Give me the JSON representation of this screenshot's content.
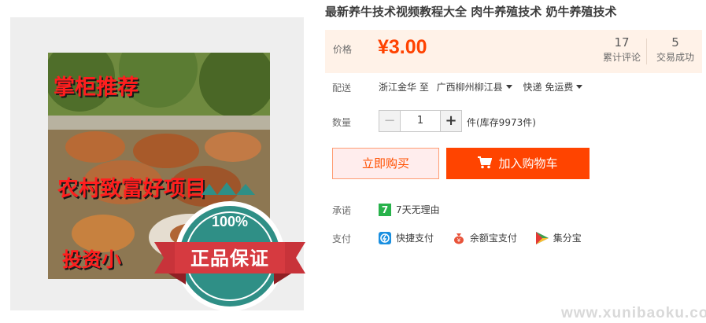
{
  "product": {
    "title": "最新养牛技术视频教程大全 肉牛养殖技术 奶牛养殖技术",
    "image_overlay": {
      "line1": "掌柜推荐",
      "line2": "农村致富好项目",
      "line3": "投资小",
      "badge_percent": "100%",
      "badge_text": "正品保证"
    }
  },
  "price": {
    "label": "价格",
    "value": "¥3.00",
    "reviews_count": "17",
    "reviews_label": "累计评论",
    "sales_count": "5",
    "sales_label": "交易成功"
  },
  "shipping": {
    "label": "配送",
    "from": "浙江金华 至",
    "to": "广西柳州柳江县",
    "method": "快递 免运费"
  },
  "quantity": {
    "label": "数量",
    "minus": "−",
    "plus": "+",
    "value": "1",
    "stock_text": "件(库存9973件)"
  },
  "actions": {
    "buy_now": "立即购买",
    "add_to_cart": "加入购物车"
  },
  "promise": {
    "label": "承诺",
    "badge": "7",
    "text": "7天无理由"
  },
  "payment": {
    "label": "支付",
    "methods": [
      "快捷支付",
      "余额宝支付",
      "集分宝"
    ]
  },
  "watermark": "www.xunibaoku.com",
  "colors": {
    "accent": "#ff4400",
    "price": "#ff4200",
    "price_bg": "#fff2e8",
    "promise_green": "#28b24b"
  }
}
